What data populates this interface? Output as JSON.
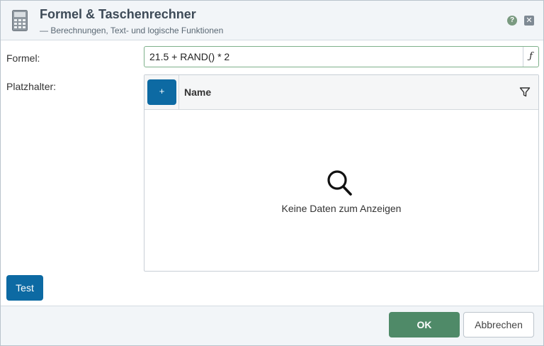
{
  "header": {
    "title": "Formel & Taschenrechner",
    "subtitle": "— Berechnungen, Text- und logische Funktionen",
    "app_icon": "calculator-icon",
    "help_label": "?",
    "close_label": "✕"
  },
  "form": {
    "formula_label": "Formel:",
    "formula_value": "21.5 + RAND() * 2",
    "function_button_label": "ƒ",
    "placeholders_label": "Platzhalter:"
  },
  "grid": {
    "add_button_label": "+",
    "columns": [
      "Name"
    ],
    "rows": [],
    "empty_text": "Keine Daten zum Anzeigen"
  },
  "actions": {
    "test_label": "Test",
    "ok_label": "OK",
    "cancel_label": "Abbrechen"
  },
  "colors": {
    "primary_blue": "#0d6aa3",
    "ok_green": "#4f8a68",
    "focus_border": "#7eb08a"
  }
}
